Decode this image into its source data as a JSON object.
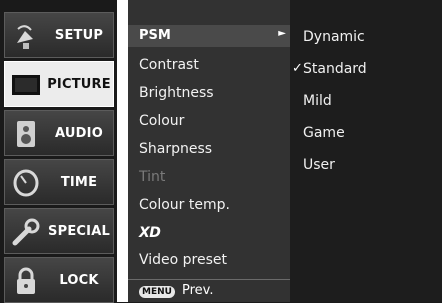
{
  "tabs": [
    {
      "label": "SETUP",
      "icon": "satellite-dish-icon",
      "active": false
    },
    {
      "label": "PICTURE",
      "icon": "tv-screen-icon",
      "active": true
    },
    {
      "label": "AUDIO",
      "icon": "speaker-icon",
      "active": false
    },
    {
      "label": "TIME",
      "icon": "clock-icon",
      "active": false
    },
    {
      "label": "SPECIAL",
      "icon": "wrench-icon",
      "active": false
    },
    {
      "label": "LOCK",
      "icon": "padlock-icon",
      "active": false
    }
  ],
  "picture_menu": {
    "psm_label": "PSM",
    "psm_arrow": "►",
    "items": [
      "Contrast",
      "Brightness",
      "Colour",
      "Sharpness",
      "Tint",
      "Colour temp."
    ],
    "disabled_item": "Tint",
    "xd_label": "XD",
    "video_preset": "Video preset",
    "footer": {
      "button": "MENU",
      "label": "Prev."
    }
  },
  "psm_options": {
    "items": [
      "Dynamic",
      "Standard",
      "Mild",
      "Game",
      "User"
    ],
    "selected": "Standard",
    "check_mark": "✓"
  }
}
